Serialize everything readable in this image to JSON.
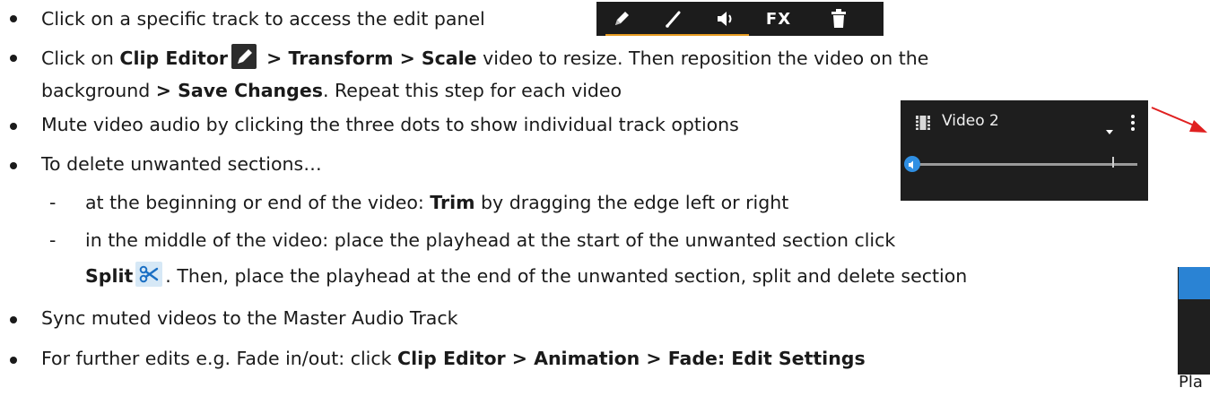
{
  "bullets": {
    "b1": "Click on a specific track to access the edit panel",
    "b2": {
      "a": "Click on ",
      "bold1": "Clip Editor",
      "bold2": " > Transform > Scale",
      "b": " video to resize. Then reposition the video on the",
      "c": "background ",
      "bold3": "> Save Changes",
      "d": ". Repeat this step for each video"
    },
    "b3": "Mute video audio by clicking the three dots to show individual track options",
    "b4": "To delete unwanted sections…",
    "sub1": {
      "a": "at the beginning or end of the video: ",
      "bold": "Trim",
      "b": " by dragging the edge left or right"
    },
    "sub2": {
      "a": "in the middle of the video: place the playhead at the start of the unwanted section click",
      "bold": "Split",
      "b": ". Then, place the playhead at the end of the unwanted section, split and delete section"
    },
    "b5": "Sync muted videos to the Master Audio Track",
    "b6": {
      "a": "For further edits e.g. Fade in/out: click ",
      "bold": "Clip Editor > Animation > Fade: Edit Settings"
    }
  },
  "toolbar": {
    "fx_label": "FX"
  },
  "track_panel": {
    "title": "Video 2"
  },
  "side_label": "Pla",
  "colors": {
    "accent_orange": "#e69b21",
    "accent_blue": "#2f8fe3",
    "arrow_red": "#e02020"
  },
  "icons": [
    "pencil-icon",
    "line-pencil-icon",
    "volume-icon",
    "trash-icon",
    "film-icon",
    "chevron-down-icon",
    "three-dots-icon",
    "scissors-icon",
    "arrow-icon"
  ]
}
